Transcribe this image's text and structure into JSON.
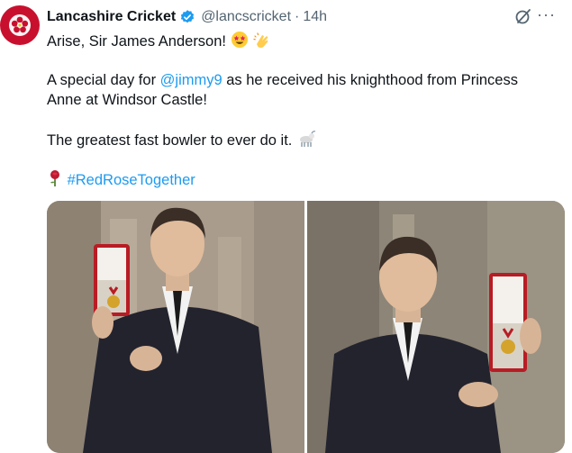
{
  "tweet": {
    "author_name": "Lancashire Cricket",
    "handle": "@lancscricket",
    "separator": "·",
    "time": "14h",
    "line1": "Arise, Sir James Anderson!",
    "line2_prefix": "A special day for ",
    "mention": "@jimmy9",
    "line2_suffix": " as he received his knighthood from Princess",
    "line3": "Anne at Windsor Castle!",
    "line4": "The greatest fast bowler to ever do it.",
    "hashtag": "#RedRoseTogether",
    "more_label": "···"
  },
  "icons": {
    "avatar": "red-rose-logo",
    "verified": "verified-badge-icon",
    "grok": "grok-icon",
    "more": "more-options-icon",
    "star_eyes": "star-struck-emoji",
    "clap": "clapping-hands-emoji",
    "goat": "goat-emoji",
    "rose": "rose-emoji"
  },
  "colors": {
    "link": "#1d9bf0",
    "brand_red": "#c8102e",
    "secondary_text": "#536471"
  }
}
